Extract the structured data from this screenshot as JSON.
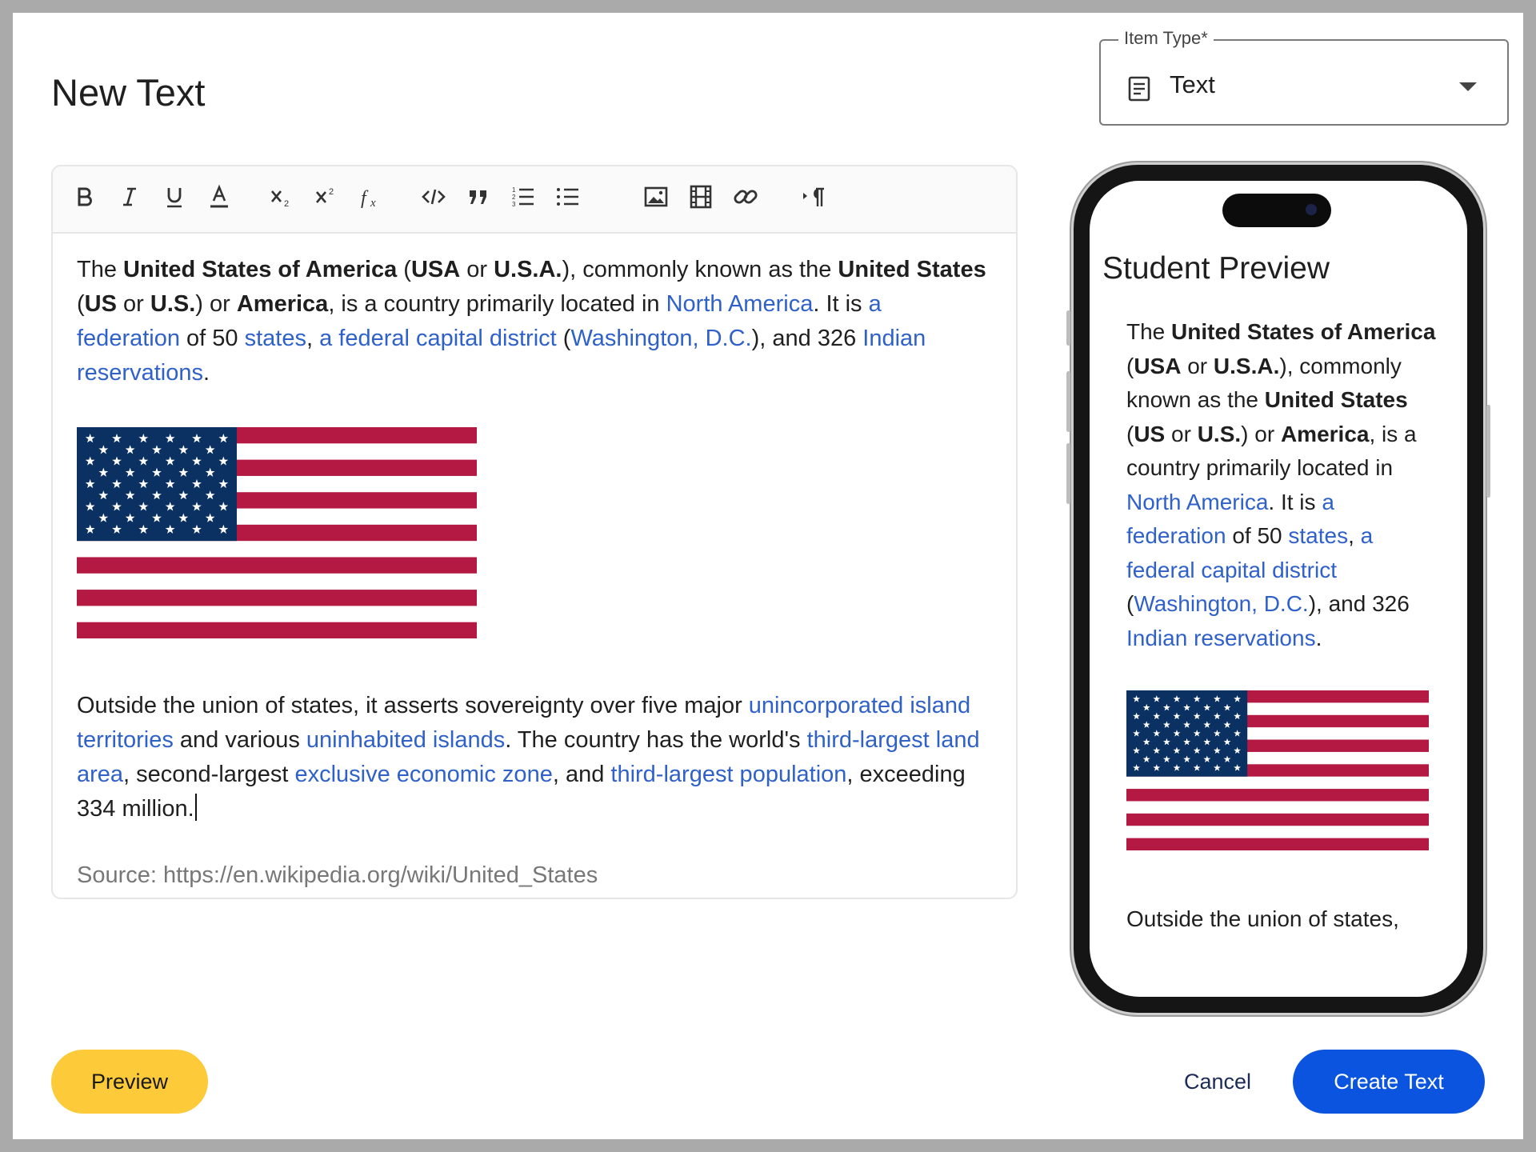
{
  "dialog": {
    "title": "New Text"
  },
  "item_type": {
    "label": "Item Type*",
    "value": "Text",
    "icon": "document-lines-icon"
  },
  "toolbar": {
    "buttons": [
      {
        "name": "bold-button",
        "icon": "bold-icon"
      },
      {
        "name": "italic-button",
        "icon": "italic-icon"
      },
      {
        "name": "underline-button",
        "icon": "underline-icon"
      },
      {
        "name": "text-color-button",
        "icon": "text-color-icon"
      },
      {
        "name": "subscript-button",
        "icon": "subscript-icon"
      },
      {
        "name": "superscript-button",
        "icon": "superscript-icon"
      },
      {
        "name": "formula-button",
        "icon": "formula-icon"
      },
      {
        "name": "code-block-button",
        "icon": "code-icon"
      },
      {
        "name": "blockquote-button",
        "icon": "quote-icon"
      },
      {
        "name": "ordered-list-button",
        "icon": "ordered-list-icon"
      },
      {
        "name": "bullet-list-button",
        "icon": "bullet-list-icon"
      },
      {
        "name": "insert-image-button",
        "icon": "image-icon"
      },
      {
        "name": "insert-video-button",
        "icon": "film-icon"
      },
      {
        "name": "insert-link-button",
        "icon": "link-icon"
      },
      {
        "name": "text-direction-button",
        "icon": "pilcrow-icon"
      }
    ]
  },
  "editor": {
    "p1": {
      "t1": "The ",
      "b1": "United States of America",
      "t2": " (",
      "b2": "USA",
      "t3": " or ",
      "b3": "U.S.A.",
      "t4": "), commonly known as the ",
      "b4": "United States",
      "t5": " (",
      "b5": "US",
      "t6": " or ",
      "b6": "U.S.",
      "t7": ") or ",
      "b7": "America",
      "t8": ", is a country primarily located in ",
      "l1": "North America",
      "t9": ". It is ",
      "l2": "a federation",
      "t10": " of 50 ",
      "l3": "states",
      "t11": ", ",
      "l4": "a federal capital district",
      "t12": " (",
      "l5": "Washington, D.C.",
      "t13": "), and 326 ",
      "l6": "Indian reservations",
      "t14": "."
    },
    "p2": {
      "t1": "Outside the union of states, it asserts sovereignty over five major ",
      "l1": "unincorporated island territories",
      "t2": " and various ",
      "l2": "uninhabited islands",
      "t3": ". The country has the world's ",
      "l3": "third-largest land area",
      "t4": ", second-largest ",
      "l4": "exclusive economic zone",
      "t5": ", and ",
      "l5": "third-largest population",
      "t6": ", exceeding 334 million."
    },
    "source": "Source: https://en.wikipedia.org/wiki/United_States",
    "flag": {
      "stripe_red": "#b31942",
      "canton_blue": "#0a3161",
      "stripes": 13,
      "stars": 50
    }
  },
  "preview": {
    "title": "Student Preview",
    "p1": {
      "t1": "The ",
      "b1": "United States of America",
      "t2": " (",
      "b2": "USA",
      "t3": " or ",
      "b3": "U.S.A.",
      "t4": "), commonly known as the ",
      "b4": "United States",
      "t5": " (",
      "b5": "US",
      "t6": " or ",
      "b6": "U.S.",
      "t7": ") or ",
      "b7": "America",
      "t8": ", is a country primarily located in ",
      "l1": "North America",
      "t9": ". It is ",
      "l2": "a federation",
      "t10": " of 50 ",
      "l3": "states",
      "t11": ", ",
      "l4": "a federal capital district",
      "t12": " (",
      "l5": "Washington, D.C.",
      "t13": "), and 326 ",
      "l6": "Indian reservations",
      "t14": "."
    },
    "p2_partial": "Outside the union of states,"
  },
  "actions": {
    "preview_label": "Preview",
    "cancel_label": "Cancel",
    "create_label": "Create Text"
  },
  "colors": {
    "link": "#2f61c9",
    "preview_button": "#fdca3a",
    "create_button": "#0b54e0",
    "cancel_text": "#1b2b55"
  }
}
